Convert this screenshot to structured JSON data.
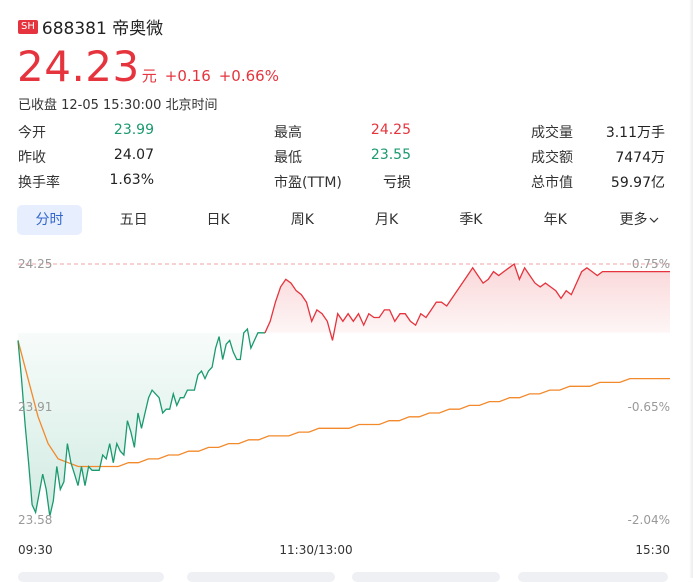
{
  "header": {
    "exchange_badge": "SH",
    "title": "688381 帝奥微"
  },
  "quote": {
    "price": "24.23",
    "unit": "元",
    "change": "+0.16",
    "change_pct": "+0.66%",
    "status": "已收盘 12-05 15:30:00 北京时间",
    "up_color": "#e5343d",
    "down_color": "#1a9a6e"
  },
  "stats": [
    [
      {
        "label": "今开",
        "value": "23.99",
        "tone": "green"
      },
      {
        "label": "最高",
        "value": "24.25",
        "tone": "red"
      },
      {
        "label": "成交量",
        "value": "3.11万手",
        "tone": ""
      }
    ],
    [
      {
        "label": "昨收",
        "value": "24.07",
        "tone": ""
      },
      {
        "label": "最低",
        "value": "23.55",
        "tone": "green"
      },
      {
        "label": "成交额",
        "value": "7474万",
        "tone": ""
      }
    ],
    [
      {
        "label": "换手率",
        "value": "1.63%",
        "tone": ""
      },
      {
        "label": "市盈(TTM)",
        "value": "亏损",
        "tone": ""
      },
      {
        "label": "总市值",
        "value": "59.97亿",
        "tone": ""
      }
    ]
  ],
  "tabs": [
    "分时",
    "五日",
    "日K",
    "周K",
    "月K",
    "季K",
    "年K",
    "更多"
  ],
  "active_tab": 0,
  "chart_data": {
    "type": "line",
    "x_ticks": [
      "09:30",
      "11:30/13:00",
      "15:30"
    ],
    "y_left_ticks": [
      "24.25",
      "23.91",
      "23.58"
    ],
    "y_right_ticks": [
      "0.75%",
      "-0.65%",
      "-2.04%"
    ],
    "ylim": [
      23.58,
      24.25
    ],
    "reference_price": 24.07,
    "grid": true,
    "series": [
      {
        "color": "#1a9a6e",
        "values": [
          24.05,
          23.95,
          23.83,
          23.73,
          23.62,
          23.6,
          23.65,
          23.7,
          23.66,
          23.59,
          23.63,
          23.72,
          23.66,
          23.68,
          23.78,
          23.73,
          23.7,
          23.67,
          23.72,
          23.67,
          23.72,
          23.71,
          23.71,
          23.71,
          23.75,
          23.74,
          23.78,
          23.73,
          23.78,
          23.76,
          23.75,
          23.84,
          23.81,
          23.77,
          23.86,
          23.82,
          23.86,
          23.9,
          23.92,
          23.91,
          23.9,
          23.86,
          23.87,
          23.87,
          23.91,
          23.88,
          23.9,
          23.9,
          23.92,
          23.92,
          23.92,
          23.96,
          23.97,
          23.95,
          23.97,
          23.98,
          24.03,
          24.06,
          24.0,
          24.04,
          24.05,
          24.02,
          24.0,
          24.0,
          24.07,
          24.08,
          24.03,
          24.05,
          24.07,
          24.07,
          24.07
        ]
      },
      {
        "color": "#e5343d",
        "values": [
          24.07,
          24.1,
          24.15,
          24.19,
          24.21,
          24.2,
          24.18,
          24.17,
          24.15,
          24.1,
          24.13,
          24.12,
          24.1,
          24.05,
          24.12,
          24.1,
          24.12,
          24.1,
          24.12,
          24.09,
          24.12,
          24.11,
          24.11,
          24.13,
          24.13,
          24.1,
          24.12,
          24.12,
          24.1,
          24.09,
          24.12,
          24.11,
          24.13,
          24.15,
          24.15,
          24.14,
          24.16,
          24.18,
          24.2,
          24.22,
          24.24,
          24.22,
          24.2,
          24.21,
          24.23,
          24.22,
          24.23,
          24.24,
          24.25,
          24.21,
          24.24,
          24.22,
          24.2,
          24.19,
          24.2,
          24.19,
          24.18,
          24.16,
          24.18,
          24.17,
          24.2,
          24.23,
          24.24,
          24.23,
          24.22,
          24.23,
          24.23,
          24.23,
          24.23,
          24.23,
          24.23,
          24.23,
          24.23,
          24.23,
          24.23,
          24.23,
          24.23,
          24.23,
          24.23
        ]
      },
      {
        "color": "#f2892b",
        "values": [
          24.05,
          23.95,
          23.85,
          23.78,
          23.74,
          23.73,
          23.72,
          23.72,
          23.72,
          23.72,
          23.72,
          23.73,
          23.73,
          23.74,
          23.74,
          23.75,
          23.75,
          23.76,
          23.76,
          23.77,
          23.77,
          23.78,
          23.78,
          23.79,
          23.79,
          23.8,
          23.8,
          23.8,
          23.81,
          23.81,
          23.82,
          23.82,
          23.82,
          23.82,
          23.83,
          23.83,
          23.83,
          23.84,
          23.84,
          23.85,
          23.85,
          23.86,
          23.86,
          23.87,
          23.87,
          23.88,
          23.88,
          23.89,
          23.89,
          23.9,
          23.9,
          23.91,
          23.91,
          23.92,
          23.92,
          23.93,
          23.93,
          23.93,
          23.94,
          23.94,
          23.94,
          23.95,
          23.95,
          23.95,
          23.95,
          23.95
        ]
      }
    ]
  }
}
